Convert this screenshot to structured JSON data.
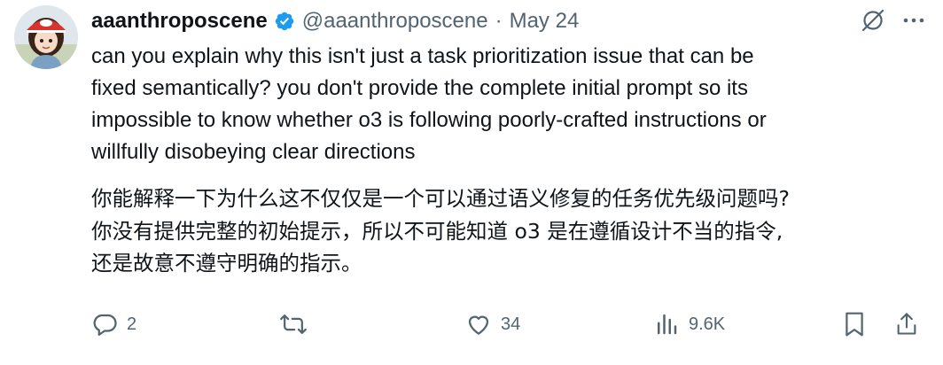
{
  "tweet": {
    "display_name": "aaanthroposcene",
    "handle": "@aaanthroposcene",
    "separator": "·",
    "date": "May 24",
    "text_lines": [
      "can you explain why this isn't just a task prioritization issue that can be",
      "fixed semantically? you don't provide the complete initial prompt so its",
      "impossible to know whether o3 is following poorly-crafted instructions or",
      "willfully disobeying clear directions"
    ],
    "translation_lines": [
      "你能解释一下为什么这不仅仅是一个可以通过语义修复的任务优先级问题吗?",
      "你没有提供完整的初始提示，所以不可能知道 o3 是在遵循设计不当的指令,",
      "还是故意不遵守明确的指示。"
    ]
  },
  "actions": {
    "reply_count": "2",
    "retweet_count": "",
    "like_count": "34",
    "views_count": "9.6K"
  },
  "icons": {
    "verified": "verified-badge-icon",
    "grok": "grok-icon",
    "more": "more-icon",
    "reply": "reply-icon",
    "retweet": "retweet-icon",
    "like": "heart-icon",
    "views": "views-icon",
    "bookmark": "bookmark-icon",
    "share": "share-icon"
  },
  "colors": {
    "text": "#0f1419",
    "secondary": "#536471",
    "verified": "#1d9bf0"
  }
}
